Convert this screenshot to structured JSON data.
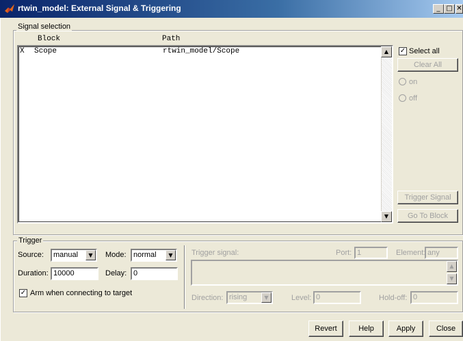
{
  "window": {
    "title": "rtwin_model: External Signal & Triggering"
  },
  "signal_selection": {
    "legend": "Signal selection",
    "columns": {
      "block": "Block",
      "path": "Path"
    },
    "rows": [
      {
        "mark": "X",
        "block": "Scope",
        "path": "rtwin_model/Scope"
      }
    ],
    "select_all_label": "Select all",
    "select_all_checked": true,
    "clear_all_label": "Clear All",
    "on_label": "on",
    "off_label": "off",
    "trigger_signal_label": "Trigger Signal",
    "go_to_block_label": "Go To Block"
  },
  "trigger": {
    "legend": "Trigger",
    "source_label": "Source:",
    "source_value": "manual",
    "mode_label": "Mode:",
    "mode_value": "normal",
    "duration_label": "Duration:",
    "duration_value": "10000",
    "delay_label": "Delay:",
    "delay_value": "0",
    "arm_label": "Arm when connecting to target",
    "arm_checked": true,
    "trigger_signal_label": "Trigger signal:",
    "port_label": "Port:",
    "port_value": "1",
    "element_label": "Element:",
    "element_value": "any",
    "direction_label": "Direction:",
    "direction_value": "rising",
    "level_label": "Level:",
    "level_value": "0",
    "holdoff_label": "Hold-off:",
    "holdoff_value": "0"
  },
  "buttons": {
    "revert": "Revert",
    "help": "Help",
    "apply": "Apply",
    "close": "Close"
  },
  "icons": {
    "checkmark": "✓",
    "minimize": "_",
    "maximize": "□",
    "close": "✕",
    "up": "▲",
    "down": "▼"
  }
}
